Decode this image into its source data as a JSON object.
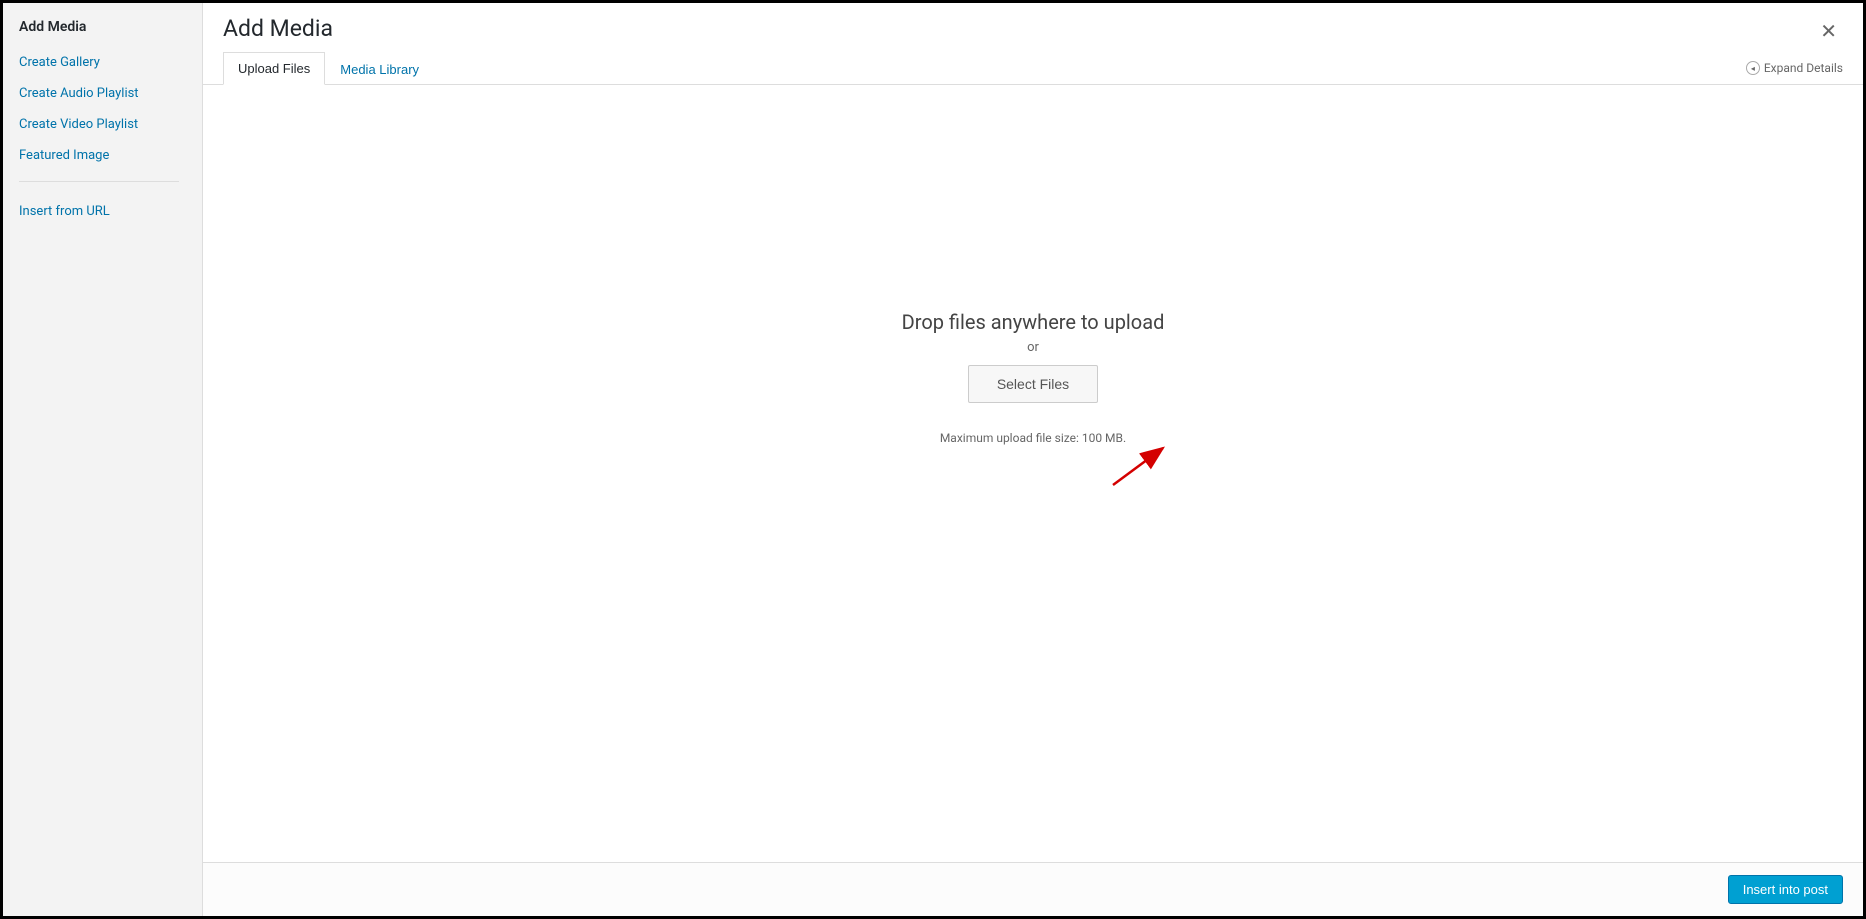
{
  "sidebar": {
    "title": "Add Media",
    "items": [
      {
        "label": "Create Gallery"
      },
      {
        "label": "Create Audio Playlist"
      },
      {
        "label": "Create Video Playlist"
      },
      {
        "label": "Featured Image"
      }
    ],
    "secondary": [
      {
        "label": "Insert from URL"
      }
    ]
  },
  "header": {
    "title": "Add Media",
    "expand_details": "Expand Details"
  },
  "tabs": {
    "upload_files": "Upload Files",
    "media_library": "Media Library"
  },
  "upload": {
    "drop_text": "Drop files anywhere to upload",
    "or_text": "or",
    "select_files": "Select Files",
    "max_size": "Maximum upload file size: 100 MB."
  },
  "footer": {
    "insert_label": "Insert into post"
  }
}
